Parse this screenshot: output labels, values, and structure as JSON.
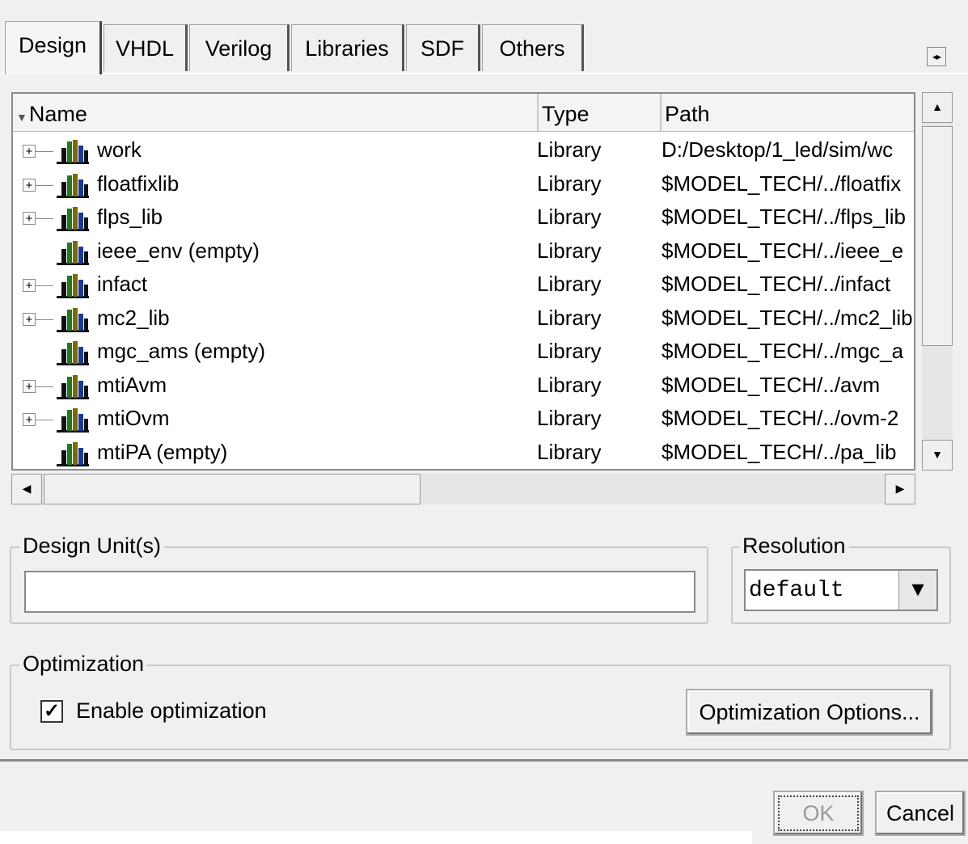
{
  "tabs": [
    {
      "label": "Design",
      "active": true
    },
    {
      "label": "VHDL",
      "active": false
    },
    {
      "label": "Verilog",
      "active": false
    },
    {
      "label": "Libraries",
      "active": false
    },
    {
      "label": "SDF",
      "active": false
    },
    {
      "label": "Others",
      "active": false
    }
  ],
  "tab_scroll": {
    "left_glyph": "◂",
    "right_glyph": "▸"
  },
  "library_list": {
    "columns": {
      "name": "Name",
      "type": "Type",
      "path": "Path"
    },
    "rows": [
      {
        "name": "work",
        "type": "Library",
        "path": "D:/Desktop/1_led/sim/wc",
        "expandable": true
      },
      {
        "name": "floatfixlib",
        "type": "Library",
        "path": "$MODEL_TECH/../floatfix",
        "expandable": true
      },
      {
        "name": "flps_lib",
        "type": "Library",
        "path": "$MODEL_TECH/../flps_lib",
        "expandable": true
      },
      {
        "name": "ieee_env  (empty)",
        "type": "Library",
        "path": "$MODEL_TECH/../ieee_e",
        "expandable": false
      },
      {
        "name": "infact",
        "type": "Library",
        "path": "$MODEL_TECH/../infact",
        "expandable": true
      },
      {
        "name": "mc2_lib",
        "type": "Library",
        "path": "$MODEL_TECH/../mc2_lib",
        "expandable": true
      },
      {
        "name": "mgc_ams  (empty)",
        "type": "Library",
        "path": "$MODEL_TECH/../mgc_a",
        "expandable": false
      },
      {
        "name": "mtiAvm",
        "type": "Library",
        "path": "$MODEL_TECH/../avm",
        "expandable": true
      },
      {
        "name": "mtiOvm",
        "type": "Library",
        "path": "$MODEL_TECH/../ovm-2",
        "expandable": true
      },
      {
        "name": "mtiPA  (empty)",
        "type": "Library",
        "path": "$MODEL_TECH/../pa_lib",
        "expandable": false
      }
    ],
    "expand_glyph": "+"
  },
  "design_units": {
    "label": "Design Unit(s)",
    "value": ""
  },
  "resolution": {
    "label": "Resolution",
    "value": "default",
    "arrow": "▼"
  },
  "optimization": {
    "label": "Optimization",
    "checkbox_label": "Enable optimization",
    "checked": true,
    "check_glyph": "✓",
    "options_button": "Optimization Options..."
  },
  "buttons": {
    "ok": "OK",
    "cancel": "Cancel"
  },
  "colors": {
    "bar_green": "#1f7a1f",
    "bar_blue": "#1a3a9a",
    "bar_olive": "#7a6a00",
    "bar_black": "#111111"
  }
}
